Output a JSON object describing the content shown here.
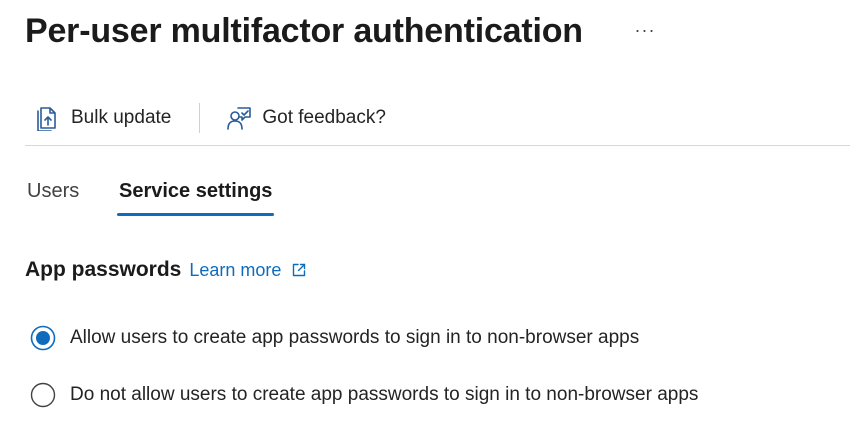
{
  "header": {
    "title": "Per-user multifactor authentication",
    "more_label": "···"
  },
  "toolbar": {
    "buttons": [
      {
        "label": "Bulk update",
        "icon": "bulk-update-icon"
      },
      {
        "label": "Got feedback?",
        "icon": "feedback-icon"
      }
    ]
  },
  "tabs": [
    {
      "label": "Users",
      "active": false
    },
    {
      "label": "Service settings",
      "active": true
    }
  ],
  "app_passwords": {
    "title": "App passwords",
    "learn_more": "Learn more",
    "options": [
      {
        "label": "Allow users to create app passwords to sign in to non-browser apps",
        "selected": true
      },
      {
        "label": "Do not allow users to create app passwords to sign in to non-browser apps",
        "selected": false
      }
    ]
  },
  "colors": {
    "accent": "#0f6cbd",
    "text": "#242424",
    "divider": "#d8d8d8"
  }
}
